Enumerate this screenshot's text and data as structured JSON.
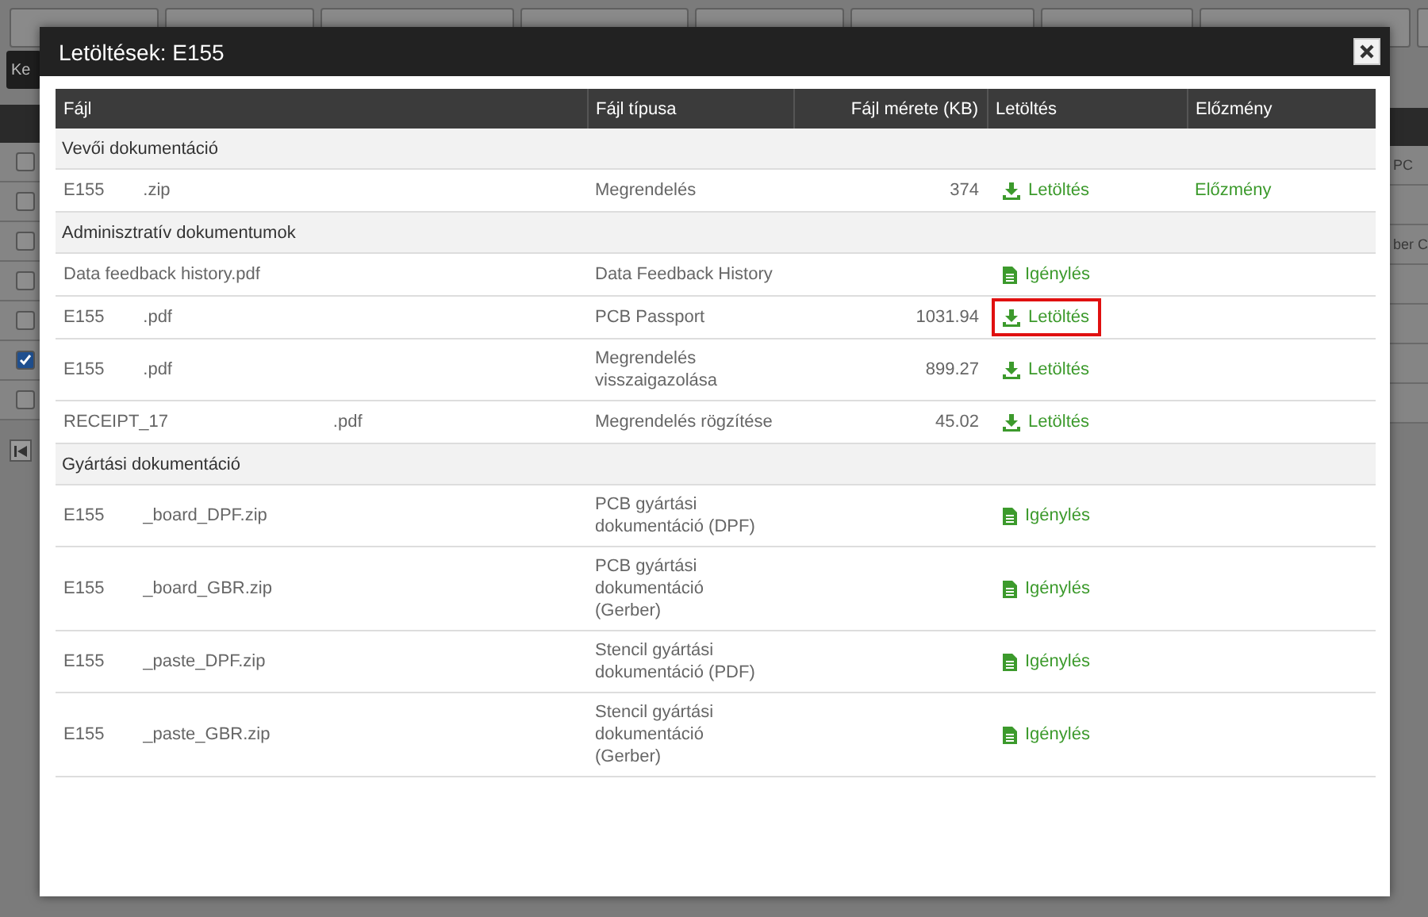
{
  "background": {
    "button": "Ke",
    "rows": [
      {
        "checked": false,
        "text": "PC"
      },
      {
        "checked": false,
        "text": ""
      },
      {
        "checked": false,
        "text": "ber C"
      },
      {
        "checked": false,
        "text": ""
      },
      {
        "checked": false,
        "text": ""
      },
      {
        "checked": true,
        "text": ""
      },
      {
        "checked": false,
        "text": ""
      }
    ]
  },
  "dialog": {
    "title": "Letöltések: E155",
    "columns": [
      "Fájl",
      "Fájl típusa",
      "Fájl mérete (KB)",
      "Letöltés",
      "Előzmény"
    ],
    "groups": [
      {
        "title": "Vevői dokumentáció",
        "rows": [
          {
            "file": "E155        .zip",
            "type": [
              "Megrendelés"
            ],
            "size": "374",
            "action": {
              "kind": "download",
              "label": "Letöltés",
              "highlighted": false
            },
            "history": "Előzmény"
          }
        ]
      },
      {
        "title": "Adminisztratív dokumentumok",
        "rows": [
          {
            "file": "Data feedback history.pdf",
            "type": [
              "Data Feedback History"
            ],
            "size": "",
            "action": {
              "kind": "request",
              "label": "Igénylés",
              "highlighted": false
            },
            "history": ""
          },
          {
            "file": "E155        .pdf",
            "type": [
              "PCB Passport"
            ],
            "size": "1031.94",
            "action": {
              "kind": "download",
              "label": "Letöltés",
              "highlighted": true
            },
            "history": ""
          },
          {
            "file": "E155        .pdf",
            "type": [
              "Megrendelés",
              "visszaigazolása"
            ],
            "size": "899.27",
            "action": {
              "kind": "download",
              "label": "Letöltés",
              "highlighted": false
            },
            "history": ""
          },
          {
            "file": "RECEIPT_17                                  .pdf",
            "type": [
              "Megrendelés rögzítése"
            ],
            "size": "45.02",
            "action": {
              "kind": "download",
              "label": "Letöltés",
              "highlighted": false
            },
            "history": ""
          }
        ]
      },
      {
        "title": "Gyártási dokumentáció",
        "rows": [
          {
            "file": "E155        _board_DPF.zip",
            "type": [
              "PCB gyártási",
              "dokumentáció (DPF)"
            ],
            "size": "",
            "action": {
              "kind": "request",
              "label": "Igénylés",
              "highlighted": false
            },
            "history": ""
          },
          {
            "file": "E155        _board_GBR.zip",
            "type": [
              "PCB gyártási",
              "dokumentáció",
              "(Gerber)"
            ],
            "size": "",
            "action": {
              "kind": "request",
              "label": "Igénylés",
              "highlighted": false
            },
            "history": ""
          },
          {
            "file": "E155        _paste_DPF.zip",
            "type": [
              "Stencil gyártási",
              "dokumentáció (PDF)"
            ],
            "size": "",
            "action": {
              "kind": "request",
              "label": "Igénylés",
              "highlighted": false
            },
            "history": ""
          },
          {
            "file": "E155        _paste_GBR.zip",
            "type": [
              "Stencil gyártási",
              "dokumentáció",
              "(Gerber)"
            ],
            "size": "",
            "action": {
              "kind": "request",
              "label": "Igénylés",
              "highlighted": false
            },
            "history": ""
          }
        ]
      }
    ]
  }
}
